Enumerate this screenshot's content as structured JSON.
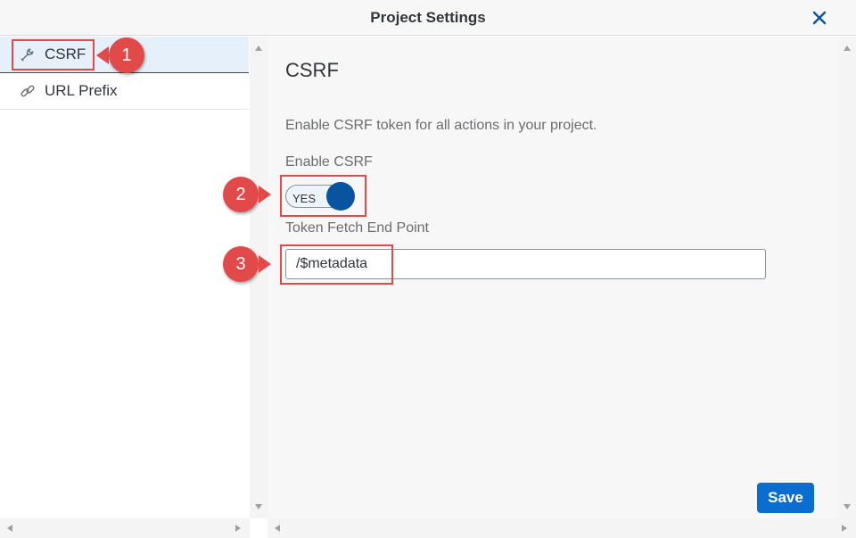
{
  "dialog": {
    "title": "Project Settings",
    "close_icon": "close-icon"
  },
  "nav": {
    "items": [
      {
        "label": "CSRF",
        "icon": "wrench-icon",
        "selected": true
      },
      {
        "label": "URL Prefix",
        "icon": "link-icon",
        "selected": false
      }
    ]
  },
  "content": {
    "section_title": "CSRF",
    "description": "Enable CSRF token for all actions in your project.",
    "enable_label": "Enable CSRF",
    "switch_text": "YES",
    "switch_on": true,
    "token_label": "Token Fetch End Point",
    "token_value": "/$metadata"
  },
  "footer": {
    "save_label": "Save"
  },
  "annotations": {
    "callout_1": "1",
    "callout_2": "2",
    "callout_3": "3"
  },
  "colors": {
    "accent": "#0854a0",
    "button": "#0a6ed1",
    "annotation": "#e24a4a"
  }
}
